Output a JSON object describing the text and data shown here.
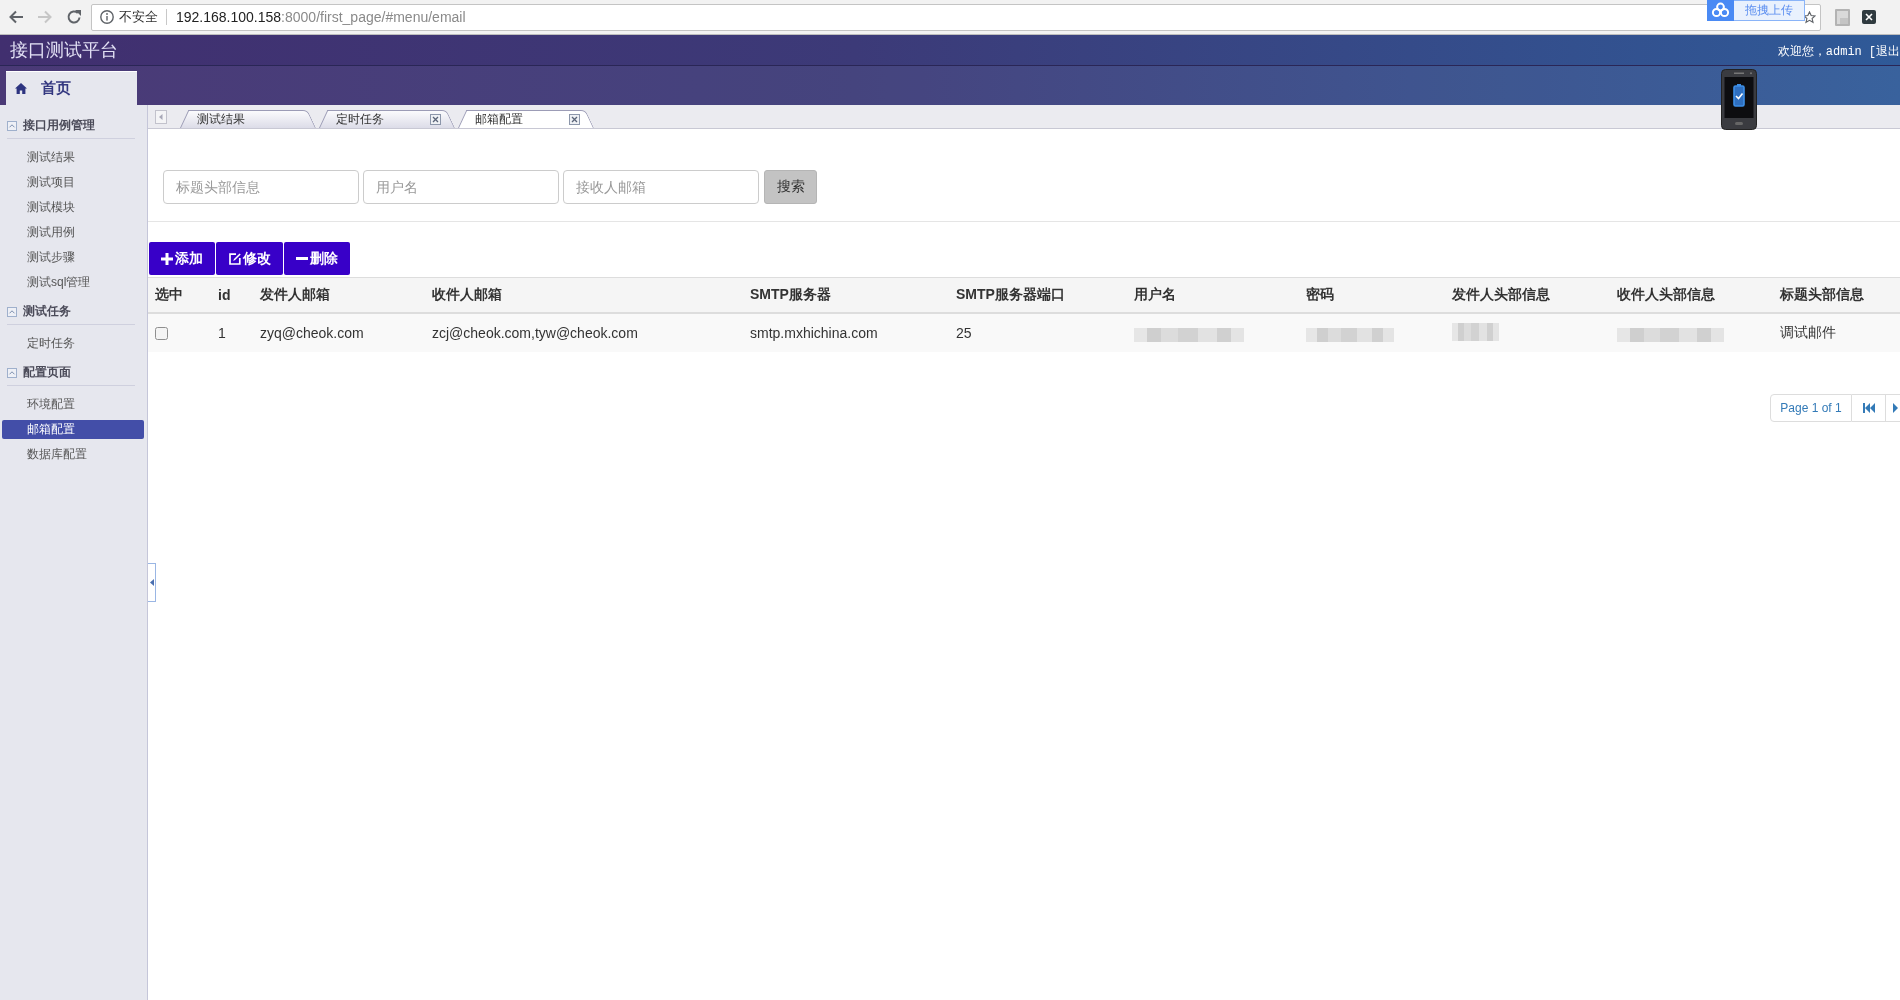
{
  "browser": {
    "forward_enabled": false,
    "security": "不安全",
    "url": {
      "host": "192.168.100.158",
      "path": ":8000/first_page/#menu/email"
    },
    "upload_widget": {
      "label": "拖拽上传"
    }
  },
  "header": {
    "title": "接口测试平台",
    "greeting": "欢迎您，admin",
    "logout_link": "[退出",
    "home_tab": {
      "label": "首页"
    }
  },
  "sidebar": {
    "groups": [
      {
        "label": "接口用例管理",
        "expanded": true,
        "items": [
          {
            "label": "测试结果",
            "selected": false
          },
          {
            "label": "测试项目",
            "selected": false
          },
          {
            "label": "测试模块",
            "selected": false
          },
          {
            "label": "测试用例",
            "selected": false
          },
          {
            "label": "测试步骤",
            "selected": false
          },
          {
            "label": "测试sql管理",
            "selected": false
          }
        ]
      },
      {
        "label": "测试任务",
        "expanded": true,
        "items": [
          {
            "label": "定时任务",
            "selected": false
          }
        ]
      },
      {
        "label": "配置页面",
        "expanded": true,
        "items": [
          {
            "label": "环境配置",
            "selected": false
          },
          {
            "label": "邮箱配置",
            "selected": true
          },
          {
            "label": "数据库配置",
            "selected": false
          }
        ]
      }
    ]
  },
  "tabs": [
    {
      "label": "测试结果",
      "selected": false,
      "closable": false
    },
    {
      "label": "定时任务",
      "selected": false,
      "closable": true
    },
    {
      "label": "邮箱配置",
      "selected": true,
      "closable": true
    }
  ],
  "search": {
    "fields": [
      {
        "placeholder": "标题头部信息"
      },
      {
        "placeholder": "用户名"
      },
      {
        "placeholder": "接收人邮箱"
      }
    ],
    "button": "搜索"
  },
  "toolbar": {
    "buttons": [
      {
        "kind": "add",
        "label": "添加"
      },
      {
        "kind": "edit",
        "label": "修改"
      },
      {
        "kind": "remove",
        "label": "删除"
      }
    ]
  },
  "table": {
    "columns": [
      "选中",
      "id",
      "发件人邮箱",
      "收件人邮箱",
      "SMTP服务器",
      "SMTP服务器端口",
      "用户名",
      "密码",
      "发件人头部信息",
      "收件人头部信息",
      "标题头部信息"
    ],
    "rows": [
      {
        "cells": [
          {
            "kind": "checkbox",
            "checked": false
          },
          {
            "kind": "text",
            "text": "1"
          },
          {
            "kind": "text",
            "text": "zyq@cheok.com"
          },
          {
            "kind": "text",
            "text": "zcj@cheok.com,tyw@cheok.com"
          },
          {
            "kind": "text",
            "text": "smtp.mxhichina.com"
          },
          {
            "kind": "text",
            "text": "25"
          },
          {
            "kind": "redacted"
          },
          {
            "kind": "redacted"
          },
          {
            "kind": "redacted"
          },
          {
            "kind": "redacted"
          },
          {
            "kind": "text",
            "text": "调试邮件"
          }
        ]
      }
    ]
  },
  "pagination": {
    "label": "Page 1 of 1"
  }
}
